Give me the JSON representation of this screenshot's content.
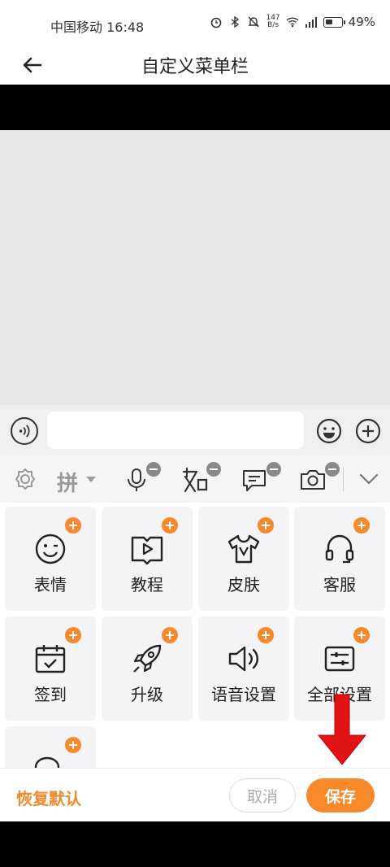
{
  "status_bar": {
    "carrier_time": "中国移动 16:48",
    "net_speed_value": "147",
    "net_speed_unit": "B/s",
    "battery_percent": "49%",
    "battery_level": 0.49
  },
  "header": {
    "title": "自定义菜单栏"
  },
  "toolbar": {
    "pinyin_label": "拼",
    "items": [
      "settings-icon",
      "microphone-icon",
      "doutu-icon",
      "text-bubble-icon",
      "camera-icon",
      "chevron-down-icon"
    ]
  },
  "grid": {
    "tiles": [
      {
        "label": "表情",
        "icon": "smiley-icon"
      },
      {
        "label": "教程",
        "icon": "video-tutorial-icon"
      },
      {
        "label": "皮肤",
        "icon": "tshirt-icon"
      },
      {
        "label": "客服",
        "icon": "headset-icon"
      },
      {
        "label": "签到",
        "icon": "calendar-check-icon"
      },
      {
        "label": "升级",
        "icon": "rocket-icon"
      },
      {
        "label": "语音设置",
        "icon": "speaker-icon"
      },
      {
        "label": "全部设置",
        "icon": "sliders-icon"
      },
      {
        "label": "",
        "icon": "chat-bubbles-icon"
      }
    ]
  },
  "bottom_bar": {
    "restore_label": "恢复默认",
    "cancel_label": "取消",
    "save_label": "保存"
  },
  "colors": {
    "accent": "#f7892a",
    "arrow": "#e01414"
  }
}
